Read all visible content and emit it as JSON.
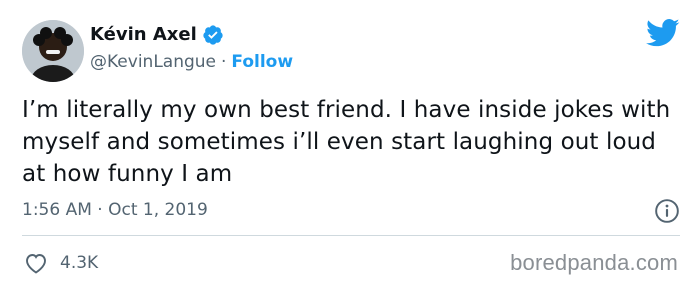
{
  "tweet": {
    "author_name": "Kévin Axel",
    "handle": "@KevinLangue",
    "separator": "·",
    "follow_label": "Follow",
    "text": "I’m literally my own best friend. I have inside jokes with myself and sometimes i’ll even start laughing out loud at how funny I am",
    "timestamp": "1:56 AM · Oct 1, 2019",
    "likes_count": "4.3K"
  },
  "icons": {
    "verified": "verified-badge-icon",
    "platform": "twitter-bird-icon",
    "info": "info-icon",
    "like": "heart-icon"
  },
  "watermark": "boredpanda.com",
  "colors": {
    "accent": "#1d9bf0",
    "secondary_text": "#536471",
    "primary_text": "#0f1419",
    "divider": "#cfd9de"
  }
}
